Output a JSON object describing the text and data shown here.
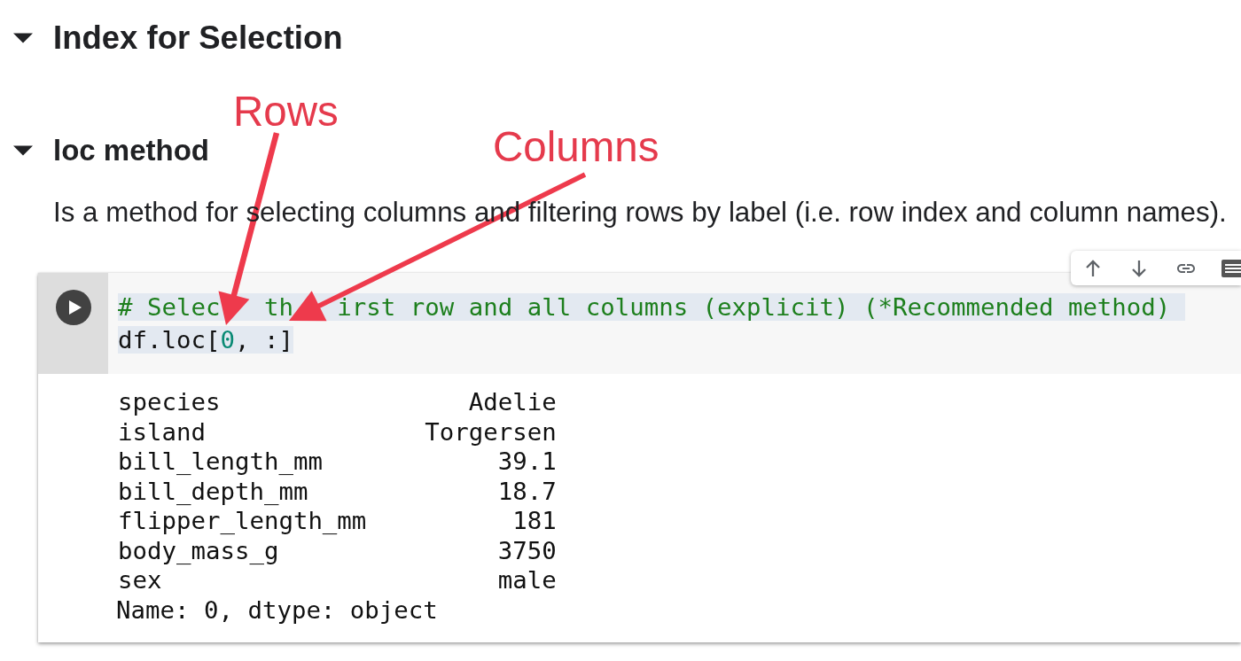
{
  "sections": [
    {
      "kind": "heading",
      "title": "Index for Selection",
      "expanded": true
    },
    {
      "kind": "subheading",
      "title": "loc method",
      "expanded": true,
      "text": "Is a method for selecting columns and filtering rows by label (i.e. row index and column names).",
      "cell": {
        "code": [
          {
            "selected": true,
            "tokens": [
              {
                "kind": "comment",
                "text": "# Selec   th   irst row and all columns (explicit) (*Recommended method)"
              }
            ]
          },
          {
            "selected": true,
            "tokens": [
              {
                "kind": "plain",
                "text": "df.loc["
              },
              {
                "kind": "number",
                "text": "0"
              },
              {
                "kind": "plain",
                "text": ", :]"
              }
            ]
          }
        ],
        "output": {
          "rows": [
            {
              "label": "species",
              "value": "Adelie"
            },
            {
              "label": "island",
              "value": "Torgersen"
            },
            {
              "label": "bill_length_mm",
              "value": "39.1"
            },
            {
              "label": "bill_depth_mm",
              "value": "18.7"
            },
            {
              "label": "flipper_length_mm",
              "value": "181"
            },
            {
              "label": "body_mass_g",
              "value": "3750"
            },
            {
              "label": "sex",
              "value": "male"
            }
          ],
          "footer": "Name: 0, dtype: object"
        }
      }
    }
  ],
  "annotations": [
    {
      "text": "Rows"
    },
    {
      "text": "Columns"
    }
  ]
}
